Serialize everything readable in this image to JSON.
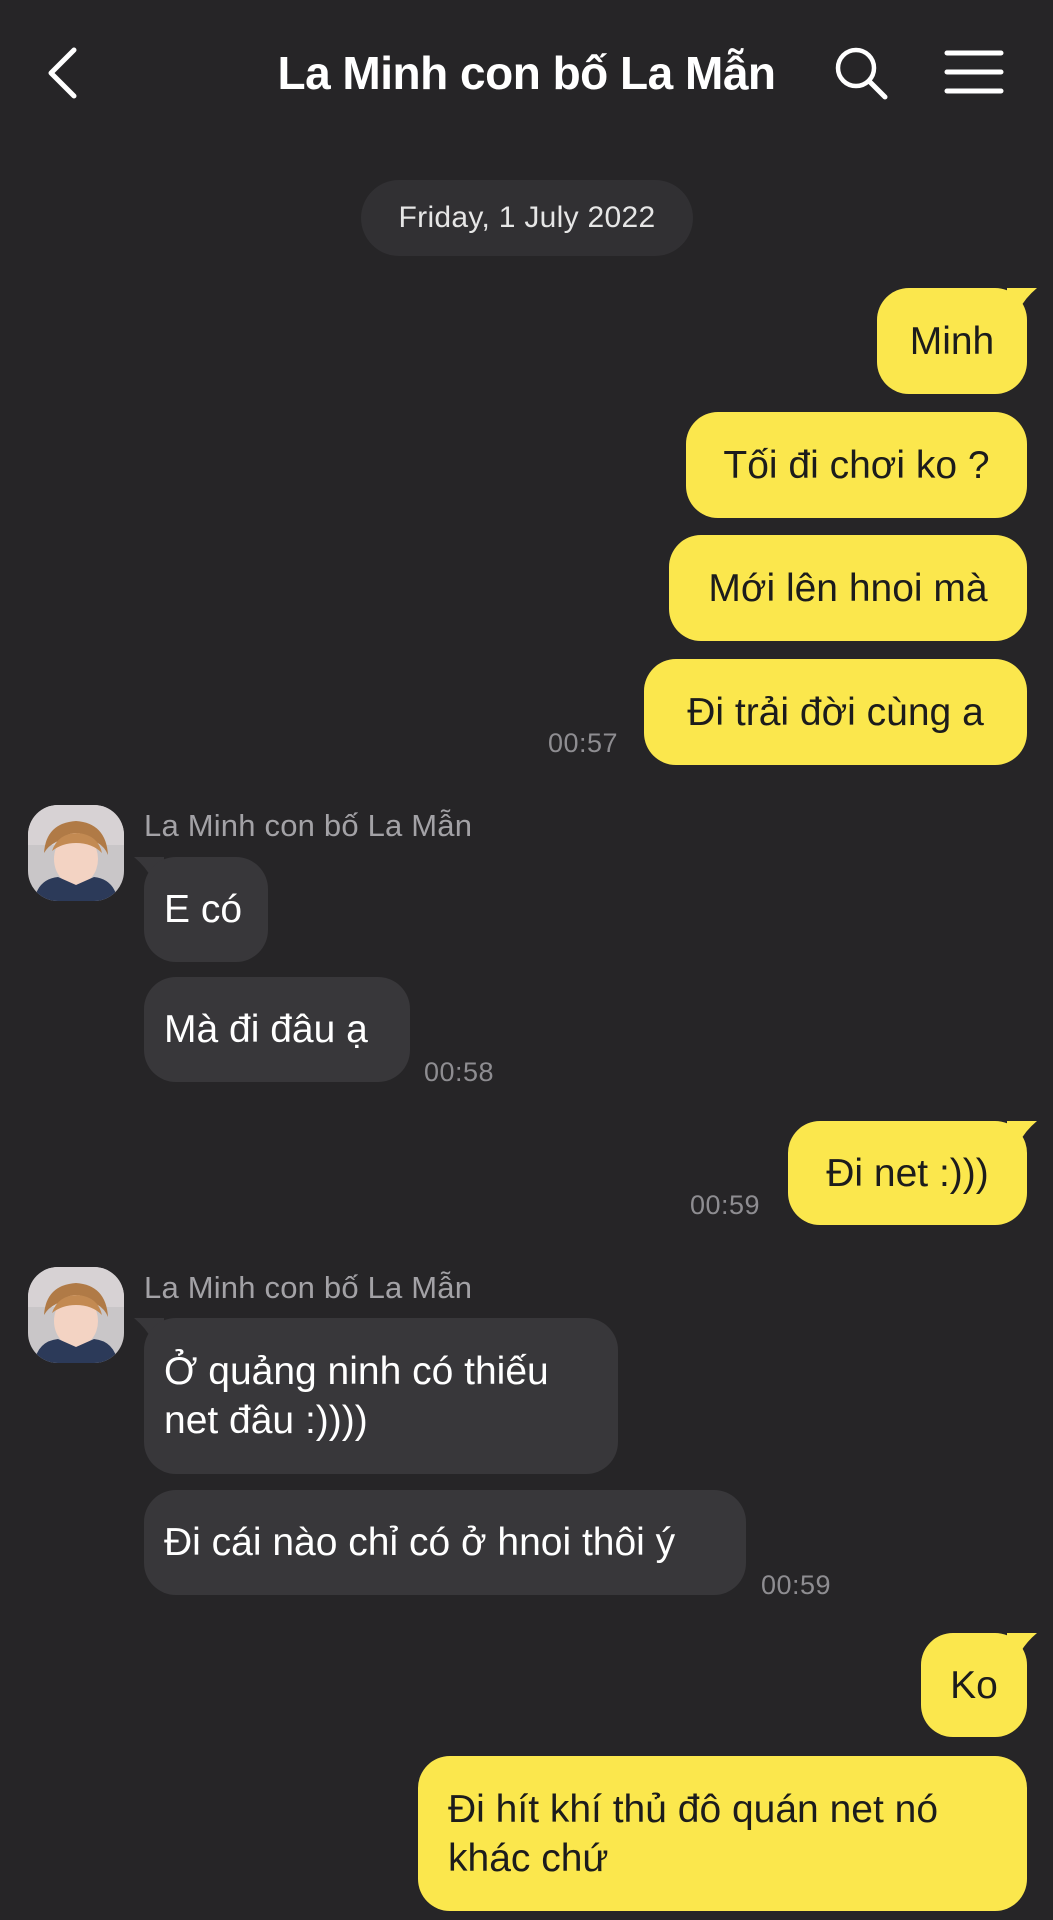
{
  "header": {
    "title": "La Minh con bố La Mẫn",
    "back_icon": "chevron-left-icon",
    "search_icon": "search-icon",
    "menu_icon": "hamburger-menu-icon"
  },
  "colors": {
    "background": "#262527",
    "outgoing_bubble": "#fbe74d",
    "incoming_bubble": "#38373a"
  },
  "date_separator": "Friday, 1 July 2022",
  "messages": {
    "m1": "Minh",
    "m2": "Tối đi chơi ko ?",
    "m3": "Mới lên hnoi mà",
    "m4": "Đi trải đời cùng a",
    "t1": "00:57",
    "sender1": "La Minh con bố La Mẫn",
    "m5": "E có",
    "m6": "Mà đi đâu ạ",
    "t2": "00:58",
    "m7": "Đi net :)))",
    "t3": "00:59",
    "sender2": "La Minh con bố La Mẫn",
    "m8a": "Ở quảng ninh có thiếu",
    "m8b": "net đâu :))))",
    "m9": "Đi cái nào chỉ có ở hnoi thôi ý",
    "t4": "00:59",
    "m10": "Ko",
    "m11a": "Đi hít khí thủ đô quán net nó",
    "m11b": "khác chứ"
  }
}
